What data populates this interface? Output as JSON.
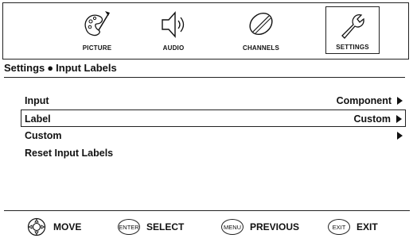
{
  "tabs": [
    {
      "label": "PICTURE",
      "icon": "palette-icon",
      "active": false
    },
    {
      "label": "AUDIO",
      "icon": "speaker-icon",
      "active": false
    },
    {
      "label": "CHANNELS",
      "icon": "satellite-dish-icon",
      "active": false
    },
    {
      "label": "SETTINGS",
      "icon": "wrench-icon",
      "active": true
    }
  ],
  "breadcrumb": {
    "parent": "Settings",
    "separator": "●",
    "current": "Input Labels"
  },
  "menu": {
    "items": [
      {
        "label": "Input",
        "value": "Component",
        "has_arrow": true,
        "selected": false
      },
      {
        "label": "Label",
        "value": "Custom",
        "has_arrow": true,
        "selected": true
      },
      {
        "label": "Custom",
        "value": "",
        "has_arrow": true,
        "selected": false
      },
      {
        "label": "Reset Input Labels",
        "value": "",
        "has_arrow": false,
        "selected": false
      }
    ]
  },
  "footer": {
    "move": {
      "key": "",
      "label": "MOVE"
    },
    "select": {
      "key": "ENTER",
      "label": "SELECT"
    },
    "previous": {
      "key": "MENU",
      "label": "PREVIOUS"
    },
    "exit": {
      "key": "EXIT",
      "label": "EXIT"
    }
  }
}
